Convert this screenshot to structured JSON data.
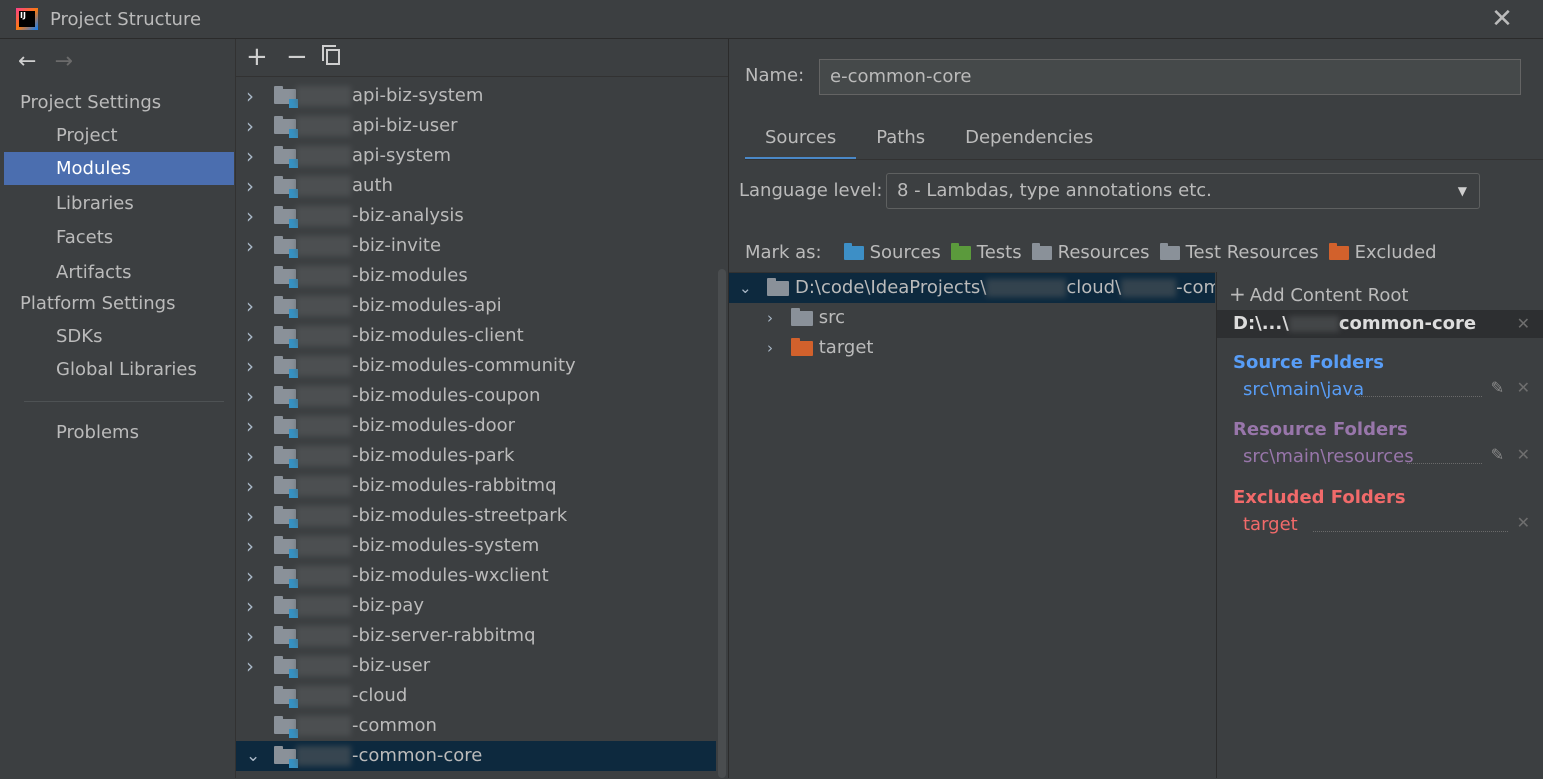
{
  "window": {
    "title": "Project Structure"
  },
  "nav": {
    "project_settings": "Project Settings",
    "project_items": [
      "Project",
      "Modules",
      "Libraries",
      "Facets",
      "Artifacts"
    ],
    "platform_settings": "Platform Settings",
    "platform_items": [
      "SDKs",
      "Global Libraries"
    ],
    "problems": "Problems",
    "selected": "Modules"
  },
  "modules": [
    {
      "name": "api-biz-system",
      "expandable": true
    },
    {
      "name": "api-biz-user",
      "expandable": true
    },
    {
      "name": "api-system",
      "expandable": true
    },
    {
      "name": "auth",
      "expandable": true
    },
    {
      "name": "-biz-analysis",
      "expandable": true
    },
    {
      "name": "-biz-invite",
      "expandable": true
    },
    {
      "name": "-biz-modules",
      "expandable": false
    },
    {
      "name": "-biz-modules-api",
      "expandable": true
    },
    {
      "name": "-biz-modules-client",
      "expandable": true
    },
    {
      "name": "-biz-modules-community",
      "expandable": true
    },
    {
      "name": "-biz-modules-coupon",
      "expandable": true
    },
    {
      "name": "-biz-modules-door",
      "expandable": true
    },
    {
      "name": "-biz-modules-park",
      "expandable": true
    },
    {
      "name": "-biz-modules-rabbitmq",
      "expandable": true
    },
    {
      "name": "-biz-modules-streetpark",
      "expandable": true
    },
    {
      "name": "-biz-modules-system",
      "expandable": true
    },
    {
      "name": "-biz-modules-wxclient",
      "expandable": true
    },
    {
      "name": "-biz-pay",
      "expandable": true
    },
    {
      "name": "-biz-server-rabbitmq",
      "expandable": true
    },
    {
      "name": "-biz-user",
      "expandable": true
    },
    {
      "name": "-cloud",
      "expandable": false
    },
    {
      "name": "-common",
      "expandable": false
    },
    {
      "name": "-common-core",
      "expandable": true,
      "expanded": true,
      "selected": true
    }
  ],
  "detail": {
    "name_label": "Name:",
    "name_value": "e-common-core",
    "tabs": [
      "Sources",
      "Paths",
      "Dependencies"
    ],
    "active_tab": "Sources",
    "language_label": "Language level:",
    "language_value": "8 - Lambdas, type annotations etc.",
    "mark_as_label": "Mark as:",
    "mark_as": [
      {
        "label": "Sources",
        "color": "#3d8fc6"
      },
      {
        "label": "Tests",
        "color": "#5b9a3c"
      },
      {
        "label": "Resources",
        "color": "#8a9199"
      },
      {
        "label": "Test Resources",
        "color": "#8a9199"
      },
      {
        "label": "Excluded",
        "color": "#d2612c"
      }
    ],
    "content_root_path_prefix": "D:\\code\\IdeaProjects\\",
    "content_root_path_mid": "cloud\\",
    "content_root_path_suffix": "-commor",
    "tree_children": [
      {
        "name": "src",
        "color": "#8a9199"
      },
      {
        "name": "target",
        "color": "#d2612c"
      }
    ],
    "add_content_root": "Add Content Root",
    "root_short_prefix": "D:\\...\\",
    "root_short_suffix": "common-core",
    "source_folders_title": "Source Folders",
    "source_folders": [
      "src\\main\\java"
    ],
    "resource_folders_title": "Resource Folders",
    "resource_folders": [
      "src\\main\\resources"
    ],
    "excluded_folders_title": "Excluded Folders",
    "excluded_folders": [
      "target"
    ]
  },
  "colors": {
    "source": "#589df6",
    "resource": "#9876aa",
    "excluded": "#f16a6a",
    "selection": "#4b6eaf",
    "tree_selection": "#0d293e"
  }
}
